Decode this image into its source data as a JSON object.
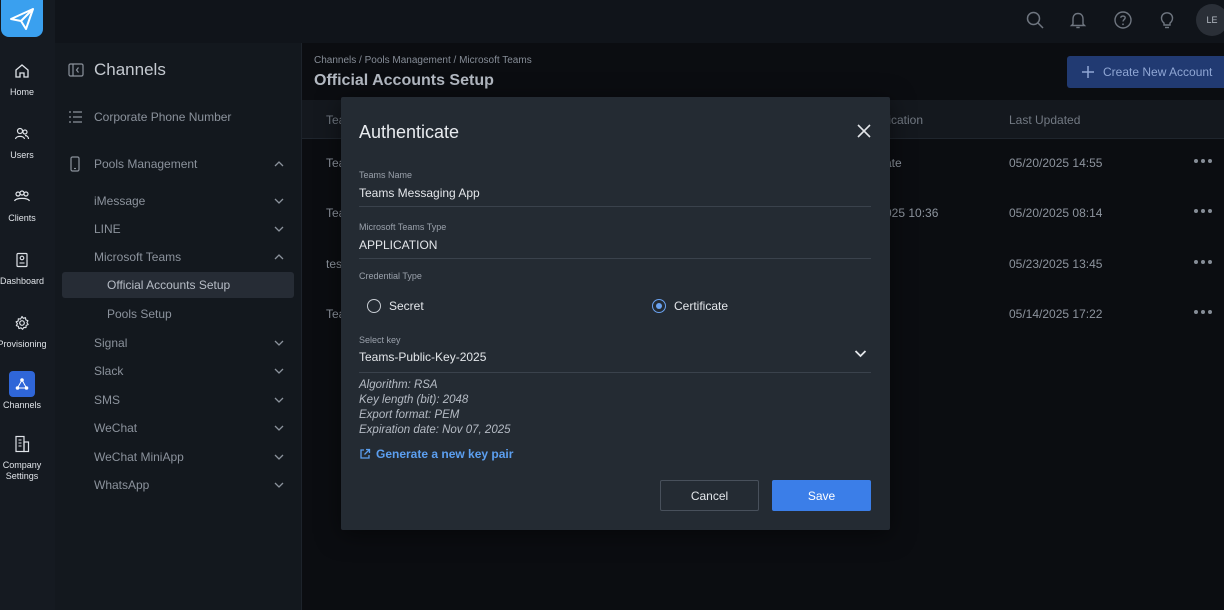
{
  "topbar": {
    "avatar_initials": "LE",
    "icons": [
      "search-icon",
      "bell-icon",
      "help-icon",
      "lightbulb-icon"
    ]
  },
  "rail": {
    "items": [
      {
        "label": "Home",
        "icon": "home-icon"
      },
      {
        "label": "Users",
        "icon": "users-icon"
      },
      {
        "label": "Clients",
        "icon": "clients-icon"
      },
      {
        "label": "Dashboard",
        "icon": "dashboard-icon"
      },
      {
        "label": "Provisioning",
        "icon": "gear-icon"
      },
      {
        "label": "Channels",
        "icon": "channels-icon"
      },
      {
        "label": "Company Settings",
        "icon": "building-icon"
      }
    ],
    "active": "Channels"
  },
  "sidebar": {
    "title": "Channels",
    "items": [
      {
        "label": "Corporate Phone Number"
      },
      {
        "label": "Pools Management"
      },
      {
        "label": "iMessage"
      },
      {
        "label": "LINE"
      },
      {
        "label": "Microsoft Teams"
      },
      {
        "label": "Official Accounts Setup"
      },
      {
        "label": "Pools Setup"
      },
      {
        "label": "Signal"
      },
      {
        "label": "Slack"
      },
      {
        "label": "SMS"
      },
      {
        "label": "WeChat"
      },
      {
        "label": "WeChat MiniApp"
      },
      {
        "label": "WhatsApp"
      }
    ]
  },
  "main": {
    "breadcrumb": "Channels / Pools Management / Microsoft Teams",
    "title": "Official Accounts Setup",
    "create_button": "Create New Account",
    "columns": {
      "name": "Tea",
      "auth": "tication",
      "updated": "Last Updated"
    },
    "rows": [
      {
        "name": "Tea",
        "auth": "ate",
        "updated": "05/20/2025 14:55"
      },
      {
        "name": "Tea",
        "auth": "025 10:36",
        "updated": "05/20/2025 08:14"
      },
      {
        "name": "tes",
        "auth": "",
        "updated": "05/23/2025 13:45"
      },
      {
        "name": "Tea",
        "auth": "",
        "updated": "05/14/2025 17:22"
      }
    ]
  },
  "modal": {
    "title": "Authenticate",
    "teams_name_label": "Teams Name",
    "teams_name_value": "Teams Messaging App",
    "teams_type_label": "Microsoft Teams Type",
    "teams_type_value": "APPLICATION",
    "credential_label": "Credential Type",
    "option_secret": "Secret",
    "option_certificate": "Certificate",
    "selected_credential": "Certificate",
    "select_key_label": "Select key",
    "select_key_value": "Teams-Public-Key-2025",
    "key_info": {
      "algorithm": "Algorithm: RSA",
      "key_length": "Key length (bit): 2048",
      "export_format": "Export format: PEM",
      "expiration": "Expiration date: Nov 07, 2025"
    },
    "generate_link": "Generate a new key pair",
    "cancel_label": "Cancel",
    "save_label": "Save"
  }
}
